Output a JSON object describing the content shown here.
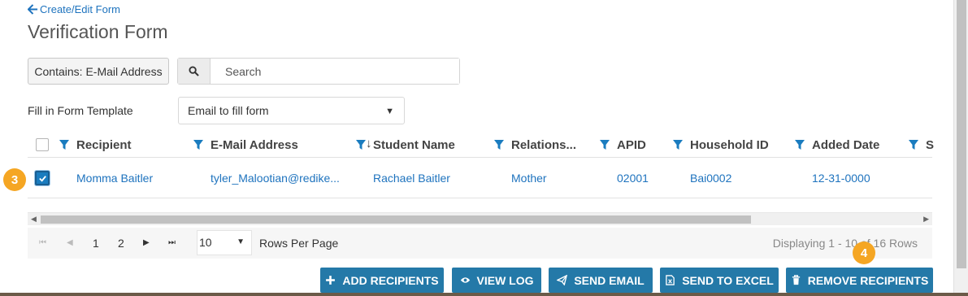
{
  "nav": {
    "back_label": "Create/Edit Form"
  },
  "page": {
    "title": "Verification Form"
  },
  "filter": {
    "contains_label": "Contains: E-Mail Address"
  },
  "search": {
    "placeholder": "Search"
  },
  "template": {
    "label": "Fill in Form Template",
    "selected": "Email to fill form"
  },
  "grid": {
    "columns": [
      "Recipient",
      "E-Mail Address",
      "Student Name",
      "Relations...",
      "APID",
      "Household ID",
      "Added Date",
      "S"
    ],
    "rows": [
      {
        "checked": true,
        "recipient": "Momma Baitler",
        "email": "tyler_Malootian@redike...",
        "student": "Rachael Baitler",
        "relationship": "Mother",
        "apid": "02001",
        "household": "Bai0002",
        "added": "12-31-0000"
      }
    ]
  },
  "pager": {
    "pages": [
      "1",
      "2"
    ],
    "per_page": "10",
    "per_page_label": "Rows Per Page",
    "display": "Displaying 1 - 10 of 16 Rows"
  },
  "actions": {
    "add": "ADD RECIPIENTS",
    "view_log": "VIEW LOG",
    "send_email": "SEND EMAIL",
    "send_excel": "SEND TO EXCEL",
    "remove": "REMOVE RECIPIENTS"
  },
  "badges": [
    "3",
    "4"
  ],
  "colors": {
    "accent": "#2479a8",
    "link": "#1e73be",
    "badge": "#f5a623"
  },
  "icons": [
    "arrow-left-icon",
    "search-icon",
    "filter-icon",
    "plus-icon",
    "eye-icon",
    "paper-plane-icon",
    "excel-file-icon",
    "trash-icon"
  ]
}
